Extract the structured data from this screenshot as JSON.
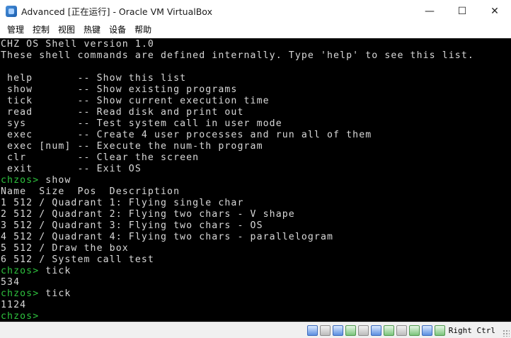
{
  "window": {
    "title": "Advanced [正在运行] - Oracle VM VirtualBox",
    "controls": {
      "minimize": "—",
      "maximize": "☐",
      "close": "✕"
    }
  },
  "menu": {
    "items": [
      {
        "label": "管理"
      },
      {
        "label": "控制"
      },
      {
        "label": "视图"
      },
      {
        "label": "热键"
      },
      {
        "label": "设备"
      },
      {
        "label": "帮助"
      }
    ]
  },
  "console": {
    "lines": [
      {
        "prompt": "",
        "text": "CHZ OS Shell version 1.0"
      },
      {
        "prompt": "",
        "text": "These shell commands are defined internally. Type 'help' to see this list."
      },
      {
        "prompt": "",
        "text": ""
      },
      {
        "prompt": "",
        "text": " help       -- Show this list"
      },
      {
        "prompt": "",
        "text": " show       -- Show existing programs"
      },
      {
        "prompt": "",
        "text": " tick       -- Show current execution time"
      },
      {
        "prompt": "",
        "text": " read       -- Read disk and print out"
      },
      {
        "prompt": "",
        "text": " sys        -- Test system call in user mode"
      },
      {
        "prompt": "",
        "text": " exec       -- Create 4 user processes and run all of them"
      },
      {
        "prompt": "",
        "text": " exec [num] -- Execute the num-th program"
      },
      {
        "prompt": "",
        "text": " clr        -- Clear the screen"
      },
      {
        "prompt": "",
        "text": " exit       -- Exit OS"
      },
      {
        "prompt": "chzos>",
        "text": " show"
      },
      {
        "prompt": "",
        "text": "Name  Size  Pos  Description"
      },
      {
        "prompt": "",
        "text": "1 512 / Quadrant 1: Flying single char"
      },
      {
        "prompt": "",
        "text": "2 512 / Quadrant 2: Flying two chars - V shape"
      },
      {
        "prompt": "",
        "text": "3 512 / Quadrant 3: Flying two chars - OS"
      },
      {
        "prompt": "",
        "text": "4 512 / Quadrant 4: Flying two chars - parallelogram"
      },
      {
        "prompt": "",
        "text": "5 512 / Draw the box"
      },
      {
        "prompt": "",
        "text": "6 512 / System call test"
      },
      {
        "prompt": "chzos>",
        "text": " tick"
      },
      {
        "prompt": "",
        "text": "534"
      },
      {
        "prompt": "chzos>",
        "text": " tick"
      },
      {
        "prompt": "",
        "text": "1124"
      },
      {
        "prompt": "chzos>",
        "text": ""
      }
    ]
  },
  "statusbar": {
    "icons": [
      "hard-disk-icon",
      "floppy-icon",
      "optical-drive-icon",
      "network-icon",
      "usb-icon",
      "shared-folders-icon",
      "display-icon",
      "video-capture-icon",
      "cpu-activity-icon",
      "virtualization-icon",
      "mouse-integration-icon"
    ],
    "host_key": "Right Ctrl"
  },
  "colors": {
    "console_bg": "#000000",
    "console_text": "#d8d8d8",
    "prompt": "#2ec23e"
  }
}
